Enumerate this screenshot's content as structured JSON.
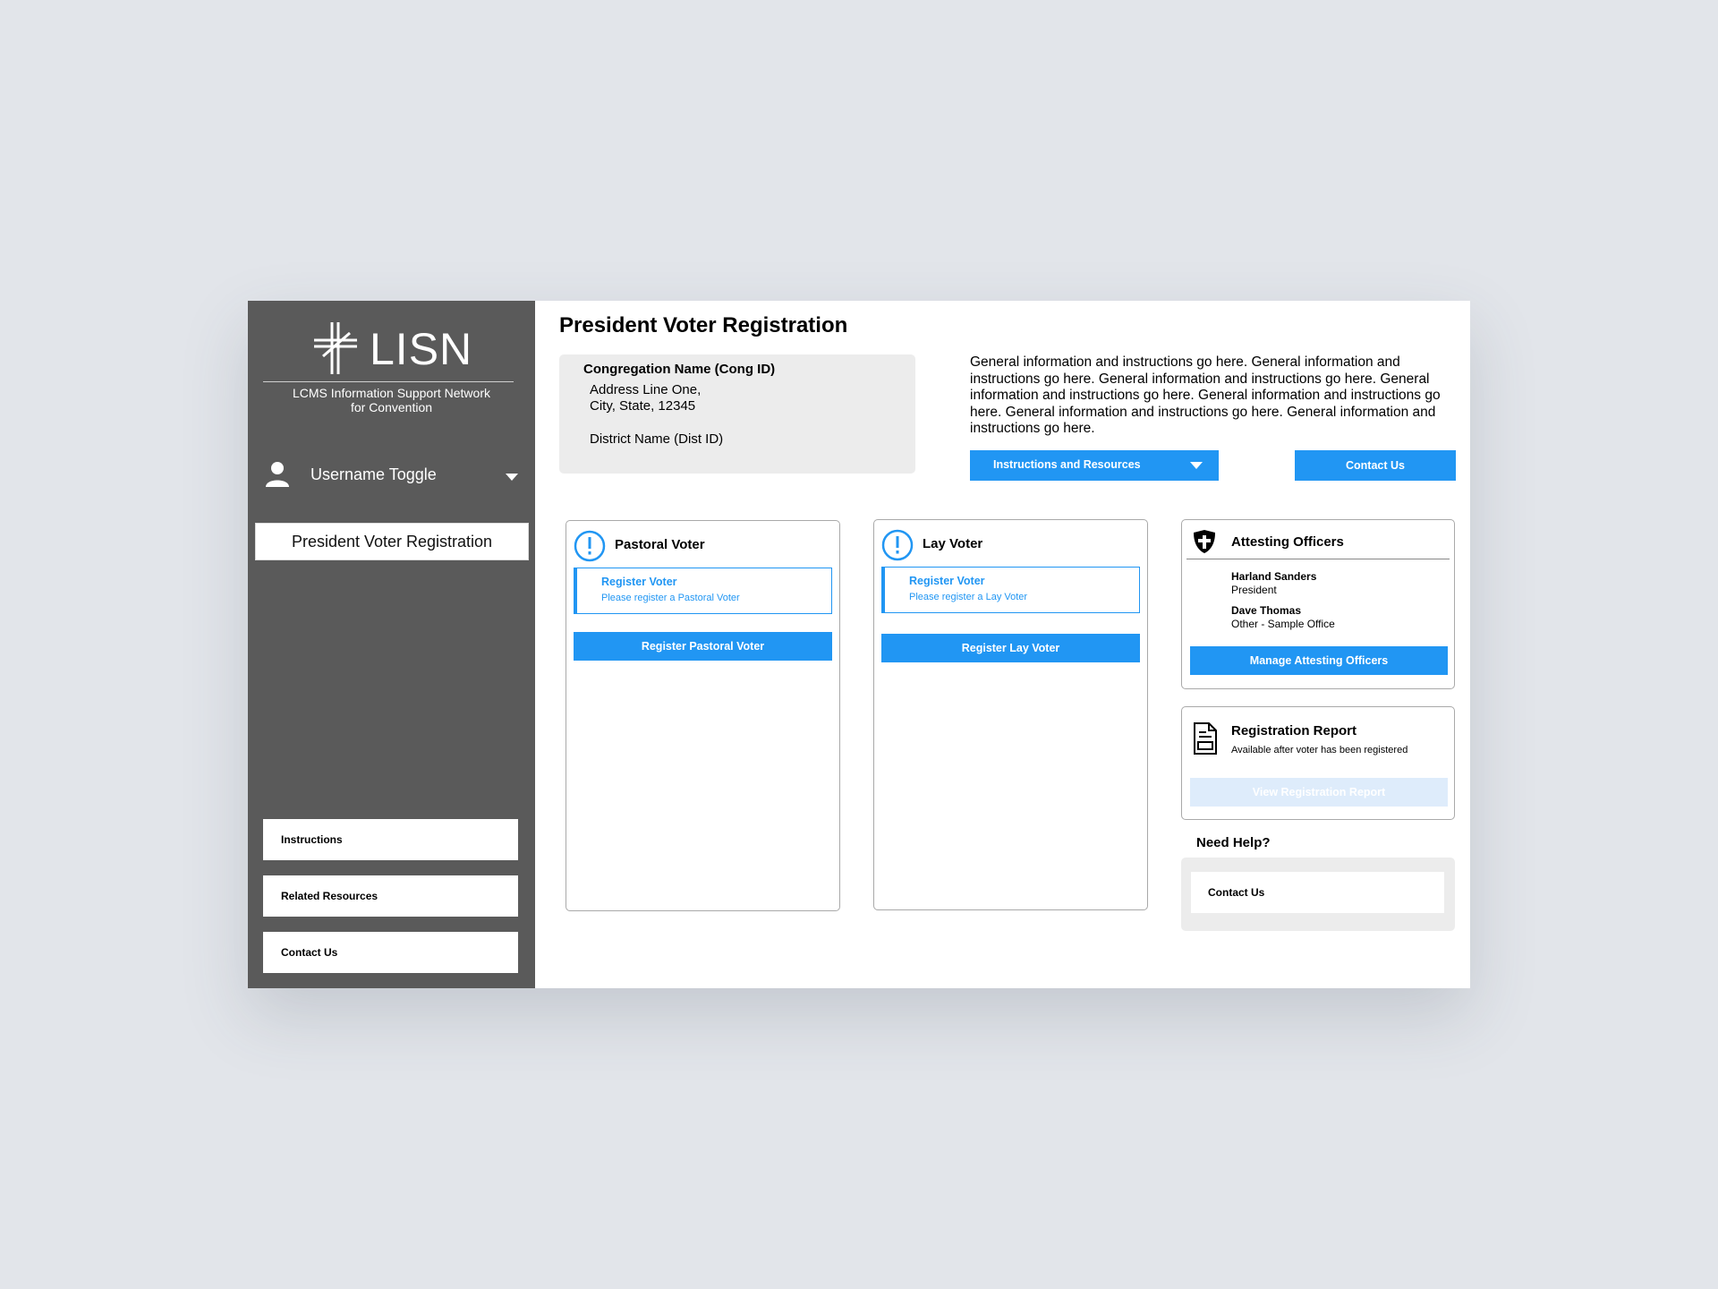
{
  "brand": {
    "name": "LISN",
    "subtitle_line1": "LCMS Information Support Network",
    "subtitle_line2": "for Convention",
    "logo_icon": "cross-icon"
  },
  "user": {
    "label": "Username Toggle",
    "icon": "user-icon"
  },
  "sidebar": {
    "active_item": "President Voter Registration",
    "links": [
      "Instructions",
      "Related Resources",
      "Contact Us"
    ]
  },
  "page": {
    "title": "President Voter Registration"
  },
  "congregation": {
    "name": "Congregation Name (Cong ID)",
    "address1": "Address Line One,",
    "address2": "City, State, 12345",
    "district": "District Name (Dist ID)"
  },
  "info": {
    "text": "General information and instructions go here. General information and instructions go here. General information and instructions go here. General information and instructions go here. General information and instructions go here. General information and instructions go here. General information and instructions go here.",
    "dropdown_label": "Instructions and  Resources",
    "contact_label": "Contact Us"
  },
  "pastoral": {
    "title": "Pastoral Voter",
    "reg_title": "Register Voter",
    "reg_sub": "Please register a Pastoral Voter",
    "button": "Register Pastoral Voter"
  },
  "lay": {
    "title": "Lay Voter",
    "reg_title": "Register Voter",
    "reg_sub": "Please register a Lay Voter",
    "button": "Register Lay Voter"
  },
  "officers": {
    "title": "Attesting Officers",
    "list": [
      {
        "name": "Harland Sanders",
        "role": "President"
      },
      {
        "name": "Dave Thomas",
        "role": "Other - Sample Office"
      }
    ],
    "button": "Manage Attesting Officers"
  },
  "report": {
    "title": "Registration Report",
    "subtitle": "Available after voter has been registered",
    "button": "View Registration Report"
  },
  "help": {
    "heading": "Need Help?",
    "link": "Contact Us"
  },
  "colors": {
    "accent": "#2196f3",
    "sidebar": "#5a5a5a",
    "panel": "#ececec",
    "disabled": "#deecfb"
  }
}
